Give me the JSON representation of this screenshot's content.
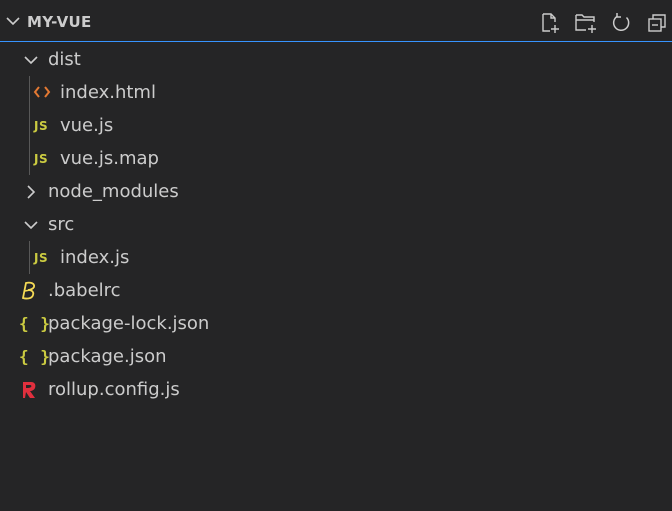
{
  "header": {
    "title": "MY-VUE",
    "actions": [
      {
        "name": "new-file",
        "icon": "new-file-icon"
      },
      {
        "name": "new-folder",
        "icon": "new-folder-icon"
      },
      {
        "name": "refresh",
        "icon": "refresh-icon"
      },
      {
        "name": "collapse-all",
        "icon": "collapse-all-icon"
      }
    ]
  },
  "tree": {
    "dist": {
      "label": "dist",
      "expanded": true
    },
    "index_html": {
      "label": "index.html",
      "icon": "html-icon"
    },
    "vue_js": {
      "label": "vue.js",
      "icon_text": "JS"
    },
    "vue_js_map": {
      "label": "vue.js.map",
      "icon_text": "JS"
    },
    "node_modules": {
      "label": "node_modules",
      "expanded": false
    },
    "src": {
      "label": "src",
      "expanded": true
    },
    "index_js": {
      "label": "index.js",
      "icon_text": "JS"
    },
    "babelrc": {
      "label": ".babelrc",
      "icon": "babel-icon"
    },
    "package_lock": {
      "label": "package-lock.json",
      "icon_text": "{ }"
    },
    "package_json": {
      "label": "package.json",
      "icon_text": "{ }"
    },
    "rollup_config": {
      "label": "rollup.config.js",
      "icon": "rollup-icon"
    }
  },
  "colors": {
    "background": "#252526",
    "text": "#cccccc",
    "focus_border": "#3794ff",
    "js_yellow": "#cbcb41",
    "html_orange": "#e37933",
    "rollup_red": "#e1303e"
  }
}
